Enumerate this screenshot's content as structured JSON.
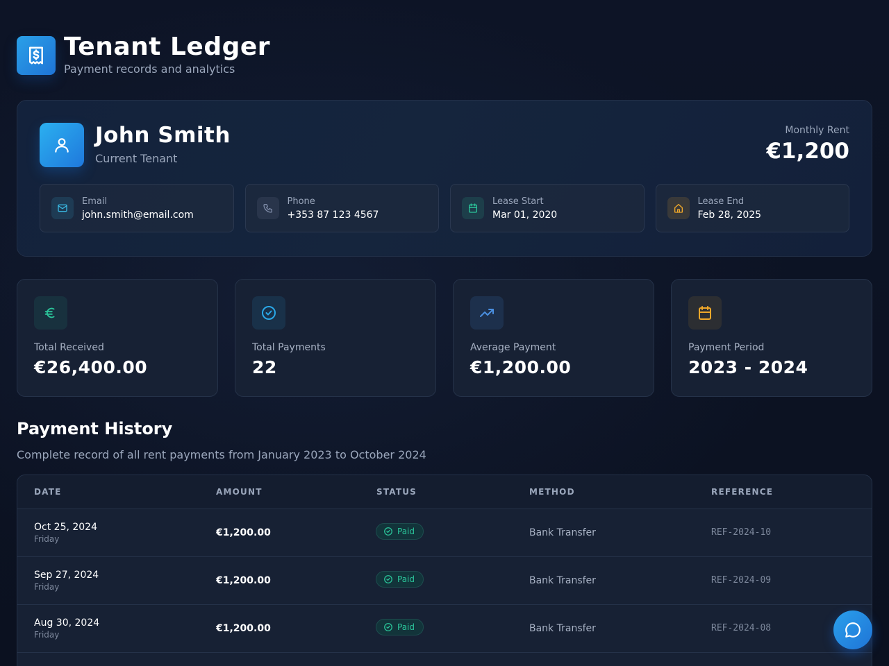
{
  "app": {
    "title": "Tenant Ledger",
    "subtitle": "Payment records and analytics",
    "logo_icon": "receipt-dollar-icon"
  },
  "tenant": {
    "name": "John Smith",
    "role": "Current Tenant",
    "avatar_icon": "user-icon",
    "monthly_rent_label": "Monthly Rent",
    "monthly_rent_value": "€1,200",
    "info": [
      {
        "label": "Email",
        "value": "john.smith@email.com",
        "icon": "mail-icon",
        "color": "#38b6e0"
      },
      {
        "label": "Phone",
        "value": "+353 87 123 4567",
        "icon": "phone-icon",
        "color": "#7d8aa6"
      },
      {
        "label": "Lease Start",
        "value": "Mar 01, 2020",
        "icon": "calendar-icon",
        "color": "#2bc59a"
      },
      {
        "label": "Lease End",
        "value": "Feb 28, 2025",
        "icon": "home-icon",
        "color": "#f0a82a"
      }
    ]
  },
  "stats": [
    {
      "label": "Total Received",
      "value": "€26,400.00",
      "icon": "euro-icon",
      "color": "#2bc59a"
    },
    {
      "label": "Total Payments",
      "value": "22",
      "icon": "check-circle-icon",
      "color": "#2aa8e8"
    },
    {
      "label": "Average Payment",
      "value": "€1,200.00",
      "icon": "trending-up-icon",
      "color": "#4a8fe0"
    },
    {
      "label": "Payment Period",
      "value": "2023 - 2024",
      "icon": "calendar-icon",
      "color": "#f0a82a"
    }
  ],
  "history": {
    "title": "Payment History",
    "subtitle": "Complete record of all rent payments from January 2023 to October 2024",
    "columns": [
      "DATE",
      "AMOUNT",
      "STATUS",
      "METHOD",
      "REFERENCE"
    ],
    "rows": [
      {
        "date": "Oct 25, 2024",
        "day": "Friday",
        "amount": "€1,200.00",
        "status": "Paid",
        "method": "Bank Transfer",
        "reference": "REF-2024-10"
      },
      {
        "date": "Sep 27, 2024",
        "day": "Friday",
        "amount": "€1,200.00",
        "status": "Paid",
        "method": "Bank Transfer",
        "reference": "REF-2024-09"
      },
      {
        "date": "Aug 30, 2024",
        "day": "Friday",
        "amount": "€1,200.00",
        "status": "Paid",
        "method": "Bank Transfer",
        "reference": "REF-2024-08"
      }
    ]
  },
  "chat": {
    "icon": "chat-bubble-icon"
  }
}
